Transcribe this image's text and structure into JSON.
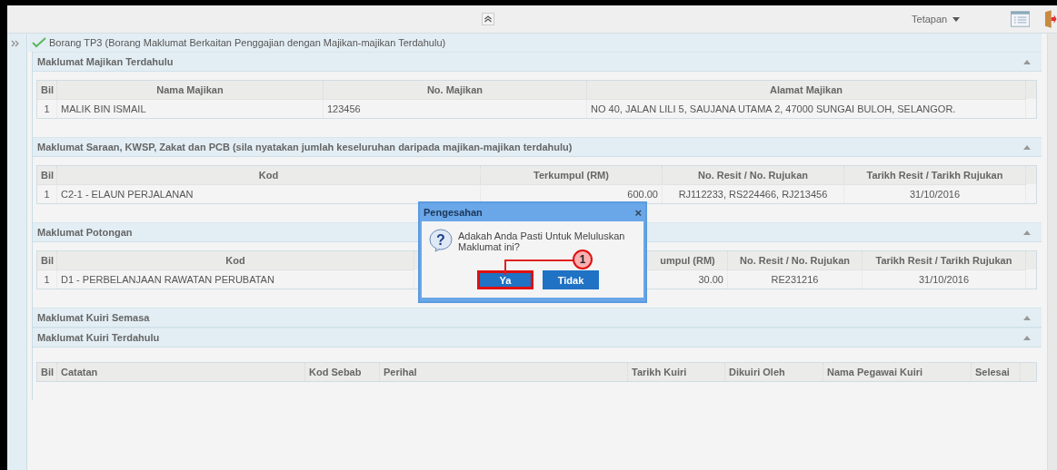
{
  "toolbar": {
    "settings_menu": "Tetapan"
  },
  "form": {
    "title": "Borang TP3 (Borang Maklumat Berkaitan Penggajian dengan Majikan-majikan Terdahulu)",
    "completed": true
  },
  "sections": [
    {
      "title": "Maklumat Majikan Terdahulu",
      "table": {
        "columns": [
          "Bil",
          "Nama Majikan",
          "No. Majikan",
          "Alamat Majikan"
        ],
        "rows": [
          [
            "1",
            "MALIK BIN ISMAIL",
            "123456",
            "NO 40, JALAN LILI 5, SAUJANA UTAMA 2, 47000 SUNGAI BULOH, SELANGOR."
          ]
        ]
      }
    },
    {
      "title": "Maklumat Saraan, KWSP, Zakat dan PCB (sila nyatakan jumlah keseluruhan daripada majikan-majikan terdahulu)",
      "table": {
        "columns": [
          "Bil",
          "Kod",
          "Terkumpul (RM)",
          "No. Resit / No. Rujukan",
          "Tarikh Resit / Tarikh Rujukan"
        ],
        "rows": [
          [
            "1",
            "C2-1 - ELAUN PERJALANAN",
            "600.00",
            "RJ112233, RS224466, RJ213456",
            "31/10/2016"
          ]
        ]
      }
    },
    {
      "title": "Maklumat Potongan",
      "table": {
        "columns": [
          "Bil",
          "Kod",
          "umpul (RM)",
          "No. Resit / No. Rujukan",
          "Tarikh Resit / Tarikh Rujukan"
        ],
        "rows": [
          [
            "1",
            "D1 - PERBELANJAAN RAWATAN PERUBATAN",
            "30.00",
            "RE231216",
            "31/10/2016"
          ]
        ]
      }
    },
    {
      "title": "Maklumat Kuiri Semasa"
    },
    {
      "title": "Maklumat Kuiri Terdahulu",
      "table": {
        "columns": [
          "Bil",
          "Catatan",
          "Kod Sebab",
          "Perihal",
          "Tarikh Kuiri",
          "Dikuiri Oleh",
          "Nama Pegawai Kuiri",
          "Selesai"
        ]
      }
    }
  ],
  "dialog": {
    "title": "Pengesahan",
    "close": "×",
    "icon": "?",
    "message": "Adakah Anda Pasti Untuk Meluluskan Maklumat ini?",
    "buttons": [
      {
        "label": "Ya",
        "highlighted": true
      },
      {
        "label": "Tidak",
        "highlighted": false
      }
    ],
    "callout": {
      "label": "1"
    }
  }
}
